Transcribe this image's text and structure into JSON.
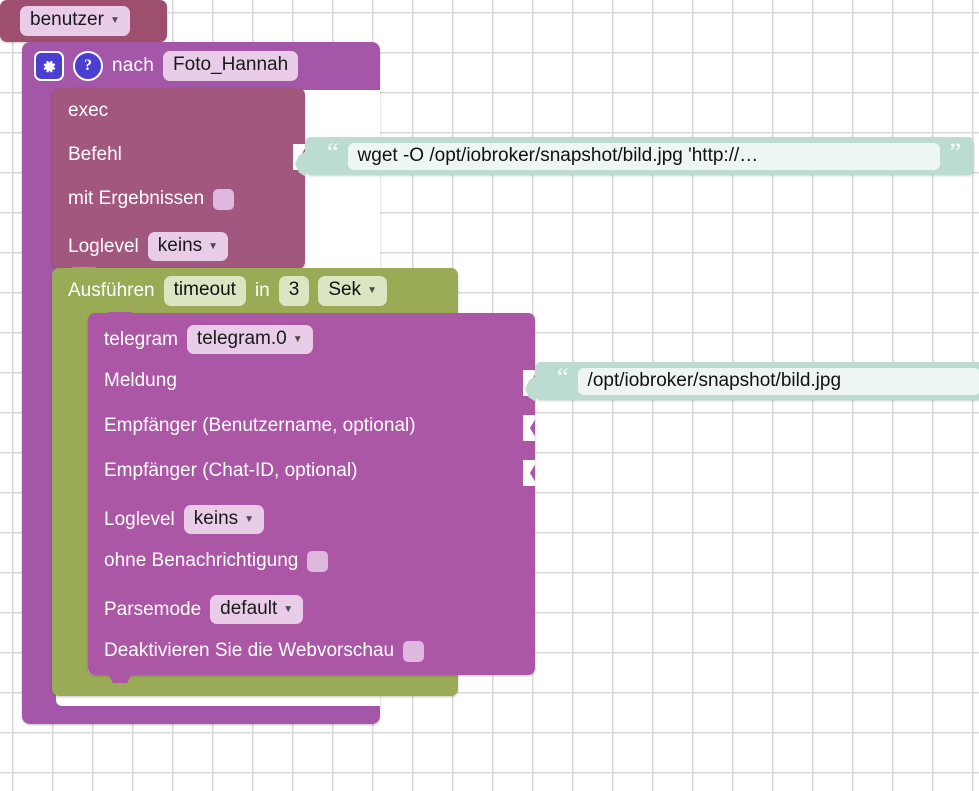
{
  "workspace": {
    "background": "#ffffff",
    "grid_color": "#d8d8d8"
  },
  "colors": {
    "event_block": "#a457a8",
    "exec_block": "#a2577f",
    "timeout_block": "#99ab55",
    "telegram_block": "#ac56a6",
    "variable_block": "#9e4f70",
    "string_block": "#bcdbd1",
    "icon_button": "#4a3fd0",
    "field_light": "#e8cce8"
  },
  "event_block": {
    "gear_icon": "gear-icon",
    "help_icon": "help-icon",
    "label": "nach",
    "name_field": "Foto_Hannah"
  },
  "exec_block": {
    "title": "exec",
    "rows": [
      {
        "label": "Befehl",
        "type": "value_input"
      },
      {
        "label": "mit Ergebnissen",
        "type": "checkbox",
        "checked": false
      },
      {
        "label": "Loglevel",
        "type": "dropdown",
        "value": "keins"
      }
    ],
    "command_string": "wget -O /opt/iobroker/snapshot/bild.jpg 'http://…"
  },
  "timeout_block": {
    "label_run": "Ausführen",
    "name_field": "timeout",
    "label_in": "in",
    "seconds_field": "3",
    "unit_dropdown": "Sek"
  },
  "telegram_block": {
    "title": "telegram",
    "instance_dropdown": "telegram.0",
    "rows": [
      {
        "label": "Meldung",
        "type": "value_input"
      },
      {
        "label": "Empfänger (Benutzername, optional)",
        "type": "value_input"
      },
      {
        "label": "Empfänger (Chat-ID, optional)",
        "type": "value_input"
      },
      {
        "label": "Loglevel",
        "type": "dropdown",
        "value": "keins"
      },
      {
        "label": "ohne Benachrichtigung",
        "type": "checkbox",
        "checked": false
      },
      {
        "label": "Parsemode",
        "type": "dropdown",
        "value": "default"
      },
      {
        "label": "Deaktivieren Sie die Webvorschau",
        "type": "checkbox",
        "checked": false
      }
    ],
    "message_string": "/opt/iobroker/snapshot/bild.jpg",
    "chat_id_variable": "benutzer"
  }
}
